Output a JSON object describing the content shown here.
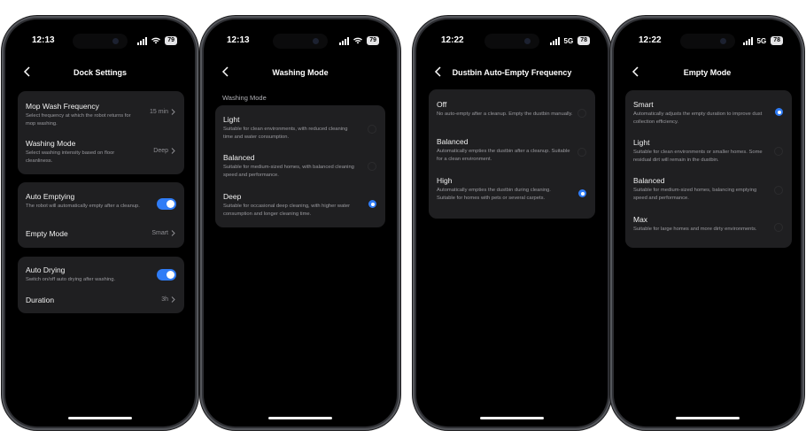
{
  "phone1": {
    "time": "12:13",
    "battery": "79",
    "title": "Dock Settings",
    "rows": [
      {
        "title": "Mop Wash Frequency",
        "desc": "Select frequency at which the robot returns for mop washing.",
        "value": "15 min"
      },
      {
        "title": "Washing Mode",
        "desc": "Select washing intensity based on floor cleanliness.",
        "value": "Deep"
      },
      {
        "title": "Auto Emptying",
        "desc": "The robot will automatically empty after a cleanup.",
        "toggle": true
      },
      {
        "title": "Empty Mode",
        "value": "Smart"
      },
      {
        "title": "Auto Drying",
        "desc": "Switch on/off auto drying after washing.",
        "toggle": true
      },
      {
        "title": "Duration",
        "value": "3h"
      }
    ]
  },
  "phone2": {
    "time": "12:13",
    "battery": "79",
    "title": "Washing Mode",
    "section": "Washing Mode",
    "options": [
      {
        "title": "Light",
        "desc": "Suitable for clean environments, with reduced cleaning time and water consumption.",
        "selected": false
      },
      {
        "title": "Balanced",
        "desc": "Suitable for medium-sized homes, with balanced cleaning speed and performance.",
        "selected": false
      },
      {
        "title": "Deep",
        "desc": "Suitable for occasional deep cleaning, with higher water consumption and longer cleaning time.",
        "selected": true
      }
    ]
  },
  "phone3": {
    "time": "12:22",
    "network": "5G",
    "battery": "78",
    "title": "Dustbin Auto-Empty Frequency",
    "options": [
      {
        "title": "Off",
        "desc": "No auto-empty after a cleanup. Empty the dustbin manually.",
        "selected": false
      },
      {
        "title": "Balanced",
        "desc": "Automatically empties the dustbin after a cleanup. Suitable for a clean environment.",
        "selected": false
      },
      {
        "title": "High",
        "desc": "Automatically empties the dustbin during cleaning. Suitable for homes with pets or several carpets.",
        "selected": true
      }
    ]
  },
  "phone4": {
    "time": "12:22",
    "network": "5G",
    "battery": "78",
    "title": "Empty Mode",
    "options": [
      {
        "title": "Smart",
        "desc": "Automatically adjusts the empty duration to improve dust collection efficiency.",
        "selected": true
      },
      {
        "title": "Light",
        "desc": "Suitable for clean environments or smaller homes. Some residual dirt will remain in the dustbin.",
        "selected": false
      },
      {
        "title": "Balanced",
        "desc": "Suitable for medium-sized homes, balancing emptying speed and performance.",
        "selected": false
      },
      {
        "title": "Max",
        "desc": "Suitable for large homes and more dirty environments.",
        "selected": false
      }
    ]
  },
  "colors": {
    "accent": "#2f7cf6",
    "card": "#1f1f21",
    "background": "#000000"
  }
}
